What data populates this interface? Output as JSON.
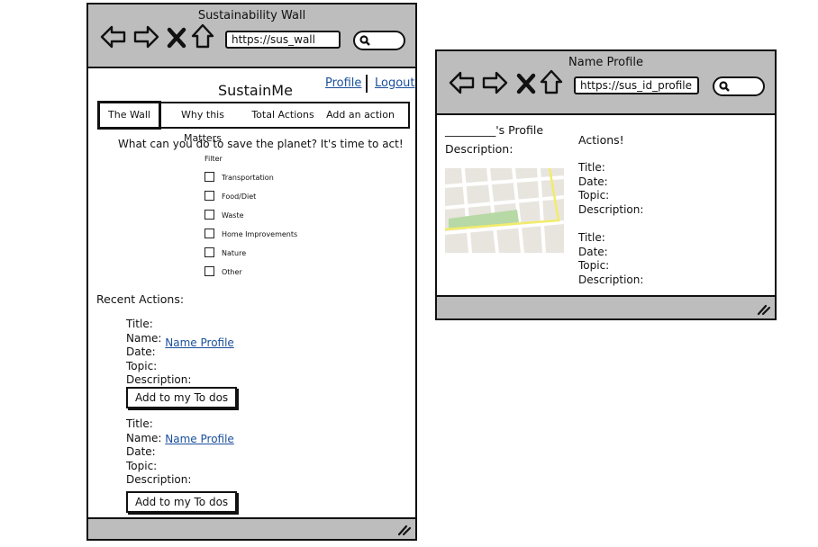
{
  "wall_window": {
    "title": "Sustainability Wall",
    "url": "https://sus_wall",
    "site_name": "SustainMe",
    "header_links": {
      "profile": "Profile",
      "logout": "Logout"
    },
    "tabs": [
      {
        "label": "The Wall",
        "active": true
      },
      {
        "label": "Why this Matters",
        "active": false
      },
      {
        "label": "Total Actions",
        "active": false
      },
      {
        "label": "Add an action",
        "active": false
      }
    ],
    "headline": "What can you do to save the planet? It's time to act!",
    "filter": {
      "label": "Filter",
      "options": [
        "Transportation",
        "Food/Diet",
        "Waste",
        "Home Improvements",
        "Nature",
        "Other"
      ]
    },
    "recent_heading": "Recent Actions:",
    "actions": [
      {
        "title_label": "Title:",
        "name_label": "Name:",
        "name_link": "Name Profile",
        "date_label": "Date:",
        "topic_label": "Topic:",
        "description_label": "Description:",
        "button": "Add to my To dos"
      },
      {
        "title_label": "Title:",
        "name_label": "Name:",
        "name_link": "Name Profile",
        "date_label": "Date:",
        "topic_label": "Topic:",
        "description_label": "Description:",
        "button": "Add to my To dos"
      }
    ]
  },
  "profile_window": {
    "title": "Name Profile",
    "url": "https://sus_id_profile",
    "profile_heading": "_________'s Profile",
    "description_label": "Description:",
    "actions_heading": "Actions!",
    "actions": [
      {
        "title_label": "Title:",
        "date_label": "Date:",
        "topic_label": "Topic:",
        "description_label": "Description:"
      },
      {
        "title_label": "Title:",
        "date_label": "Date:",
        "topic_label": "Topic:",
        "description_label": "Description:"
      }
    ]
  },
  "icons": [
    "back-arrow-icon",
    "forward-arrow-icon",
    "close-x-icon",
    "home-icon",
    "search-icon",
    "resize-grip-icon",
    "map-image"
  ],
  "colors": {
    "chrome": "#bdbdbd",
    "link": "#1a4f9c",
    "map_bg": "#e8e5df",
    "map_park": "#b7d9a5",
    "map_road_highlight": "#f2ec6a"
  }
}
